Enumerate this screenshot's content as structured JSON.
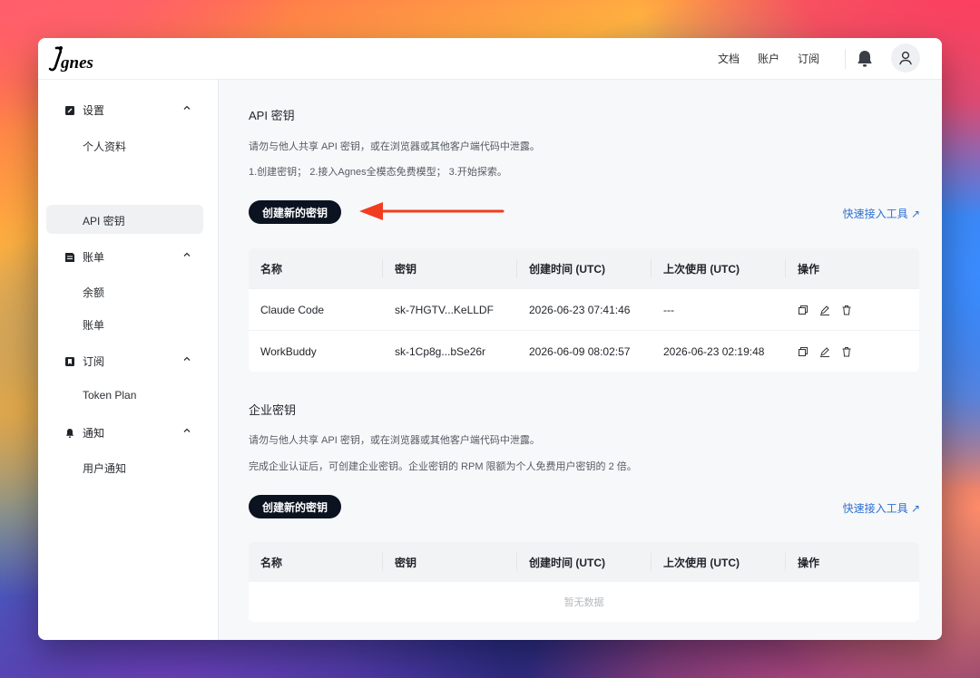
{
  "topnav": {
    "links": [
      "文档",
      "账户",
      "订阅"
    ]
  },
  "sidebar": {
    "sections": [
      {
        "label": "设置",
        "items": [
          "个人资料",
          "API 密钥"
        ]
      },
      {
        "label": "账单",
        "items": [
          "余额",
          "账单"
        ]
      },
      {
        "label": "订阅",
        "items": [
          "Token Plan"
        ]
      },
      {
        "label": "通知",
        "items": [
          "用户通知"
        ]
      }
    ],
    "active_item": "API 密钥"
  },
  "api_keys": {
    "title": "API 密钥",
    "warning": "请勿与他人共享 API 密钥，或在浏览器或其他客户端代码中泄露。",
    "steps": "1.创建密钥； 2.接入Agnes全模态免费模型； 3.开始探索。",
    "create_button": "创建新的密钥",
    "quick_link": "快速接入工具 ↗",
    "columns": [
      "名称",
      "密钥",
      "创建时间 (UTC)",
      "上次使用 (UTC)",
      "操作"
    ],
    "rows": [
      {
        "name": "Claude Code",
        "key": "sk-7HGTV...KeLLDF",
        "created": "2026-06-23 07:41:46",
        "last_used": "---"
      },
      {
        "name": "WorkBuddy",
        "key": "sk-1Cp8g...bSe26r",
        "created": "2026-06-09 08:02:57",
        "last_used": "2026-06-23 02:19:48"
      }
    ]
  },
  "enterprise_keys": {
    "title": "企业密钥",
    "warning": "请勿与他人共享 API 密钥，或在浏览器或其他客户端代码中泄露。",
    "note": "完成企业认证后，可创建企业密钥。企业密钥的 RPM 限额为个人免费用户密钥的 2 倍。",
    "create_button": "创建新的密钥",
    "quick_link": "快速接入工具 ↗",
    "columns": [
      "名称",
      "密钥",
      "创建时间 (UTC)",
      "上次使用 (UTC)",
      "操作"
    ],
    "empty_text": "暂无数据"
  },
  "icons": {
    "copy": "copy-icon",
    "edit": "edit-icon",
    "delete": "trash-icon"
  },
  "colors": {
    "accent": "#2d6fd0",
    "button": "#0b1220",
    "arrow": "#f23c1f"
  }
}
